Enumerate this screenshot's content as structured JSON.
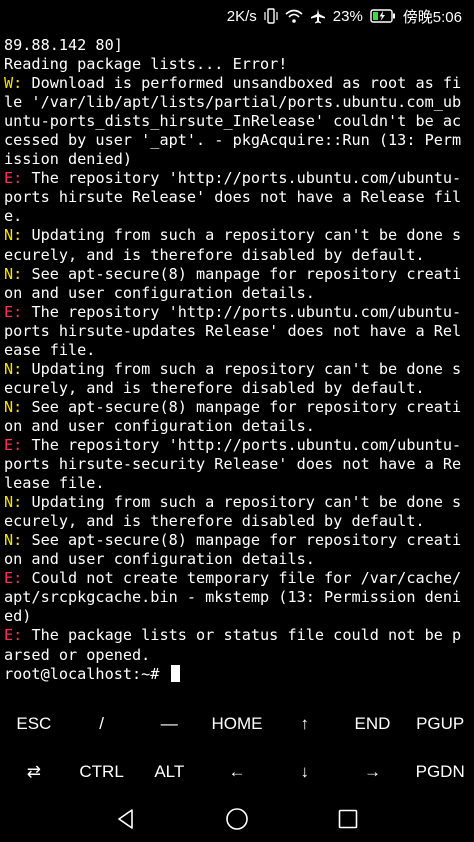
{
  "status_bar": {
    "network_speed": "2K/s",
    "battery_percent": "23%",
    "time": "傍晚5:06"
  },
  "terminal": {
    "lines": [
      {
        "prefix": "",
        "text": "89.88.142 80]"
      },
      {
        "prefix": "",
        "text": "Reading package lists... Error!"
      },
      {
        "prefix": "W:",
        "text": " Download is performed unsandboxed as root as fi"
      },
      {
        "prefix": "",
        "text": "le '/var/lib/apt/lists/partial/ports.ubuntu.com_ub"
      },
      {
        "prefix": "",
        "text": "untu-ports_dists_hirsute_InRelease' couldn't be ac"
      },
      {
        "prefix": "",
        "text": "cessed by user '_apt'. - pkgAcquire::Run (13: Perm"
      },
      {
        "prefix": "",
        "text": "ission denied)"
      },
      {
        "prefix": "E:",
        "text": " The repository 'http://ports.ubuntu.com/ubuntu-"
      },
      {
        "prefix": "",
        "text": "ports hirsute Release' does not have a Release fil"
      },
      {
        "prefix": "",
        "text": "e."
      },
      {
        "prefix": "N:",
        "text": " Updating from such a repository can't be done s"
      },
      {
        "prefix": "",
        "text": "ecurely, and is therefore disabled by default."
      },
      {
        "prefix": "N:",
        "text": " See apt-secure(8) manpage for repository creati"
      },
      {
        "prefix": "",
        "text": "on and user configuration details."
      },
      {
        "prefix": "E:",
        "text": " The repository 'http://ports.ubuntu.com/ubuntu-"
      },
      {
        "prefix": "",
        "text": "ports hirsute-updates Release' does not have a Rel"
      },
      {
        "prefix": "",
        "text": "ease file."
      },
      {
        "prefix": "N:",
        "text": " Updating from such a repository can't be done s"
      },
      {
        "prefix": "",
        "text": "ecurely, and is therefore disabled by default."
      },
      {
        "prefix": "N:",
        "text": " See apt-secure(8) manpage for repository creati"
      },
      {
        "prefix": "",
        "text": "on and user configuration details."
      },
      {
        "prefix": "E:",
        "text": " The repository 'http://ports.ubuntu.com/ubuntu-"
      },
      {
        "prefix": "",
        "text": "ports hirsute-security Release' does not have a Re"
      },
      {
        "prefix": "",
        "text": "lease file."
      },
      {
        "prefix": "N:",
        "text": " Updating from such a repository can't be done s"
      },
      {
        "prefix": "",
        "text": "ecurely, and is therefore disabled by default."
      },
      {
        "prefix": "N:",
        "text": " See apt-secure(8) manpage for repository creati"
      },
      {
        "prefix": "",
        "text": "on and user configuration details."
      },
      {
        "prefix": "E:",
        "text": " Could not create temporary file for /var/cache/"
      },
      {
        "prefix": "",
        "text": "apt/srcpkgcache.bin - mkstemp (13: Permission deni"
      },
      {
        "prefix": "",
        "text": "ed)"
      },
      {
        "prefix": "E:",
        "text": " The package lists or status file could not be p"
      },
      {
        "prefix": "",
        "text": "arsed or opened."
      }
    ],
    "prompt": "root@localhost:~# "
  },
  "extra_keys": {
    "row1": [
      "ESC",
      "/",
      "—",
      "HOME",
      "↑",
      "END",
      "PGUP"
    ],
    "row2": [
      "⇄",
      "CTRL",
      "ALT",
      "←",
      "↓",
      "→",
      "PGDN"
    ]
  },
  "colors": {
    "warning_prefix": "#f5e100",
    "error_prefix": "#ff2d55",
    "notice_prefix": "#f5e100",
    "background": "#000000",
    "text": "#ffffff"
  }
}
